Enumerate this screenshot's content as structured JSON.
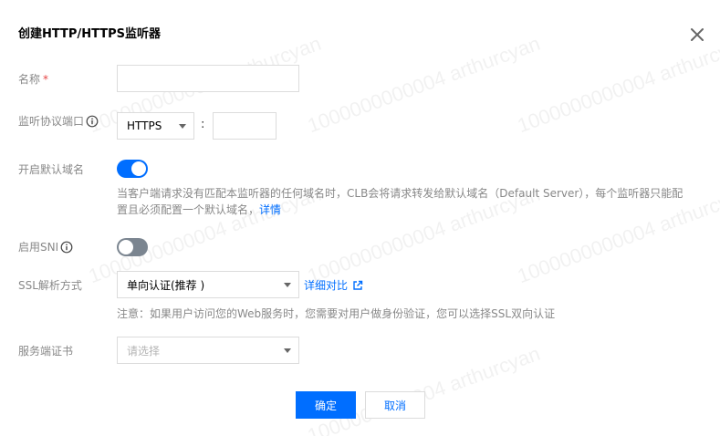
{
  "dialog": {
    "title": "创建HTTP/HTTPS监听器"
  },
  "watermark": {
    "text": "1000000000004 arthurcyan"
  },
  "form": {
    "name": {
      "label": "名称",
      "required_mark": "*",
      "value": "",
      "placeholder": ""
    },
    "protocol_port": {
      "label": "监听协议端口",
      "protocol_value": "HTTPS",
      "separator": ":",
      "port_value": ""
    },
    "default_domain": {
      "label": "开启默认域名",
      "enabled": true,
      "description": "当客户端请求没有匹配本监听器的任何域名时，CLB会将请求转发给默认域名（Default Server），每个监听器只能配置且必须配置一个默认域名，",
      "description_line1": "当客户端请求没有匹配本监听器的任何域名时，CLB会将请求转发给默认域名（Default Server），每个监听器只能配",
      "description_line2": "置且必须配置一个默认域名，",
      "details_link": "详情"
    },
    "sni": {
      "label": "启用SNI",
      "enabled": false
    },
    "ssl_mode": {
      "label": "SSL解析方式",
      "value": "单向认证(推荐 )",
      "compare_link": "详细对比",
      "note": "注意：如果用户访问您的Web服务时，您需要对用户做身份验证，您可以选择SSL双向认证"
    },
    "server_cert": {
      "label": "服务端证书",
      "placeholder": "请选择"
    }
  },
  "buttons": {
    "confirm": "确定",
    "cancel": "取消"
  },
  "colors": {
    "primary": "#006eff",
    "required": "#e54545",
    "toggle_off": "#7b8590"
  }
}
